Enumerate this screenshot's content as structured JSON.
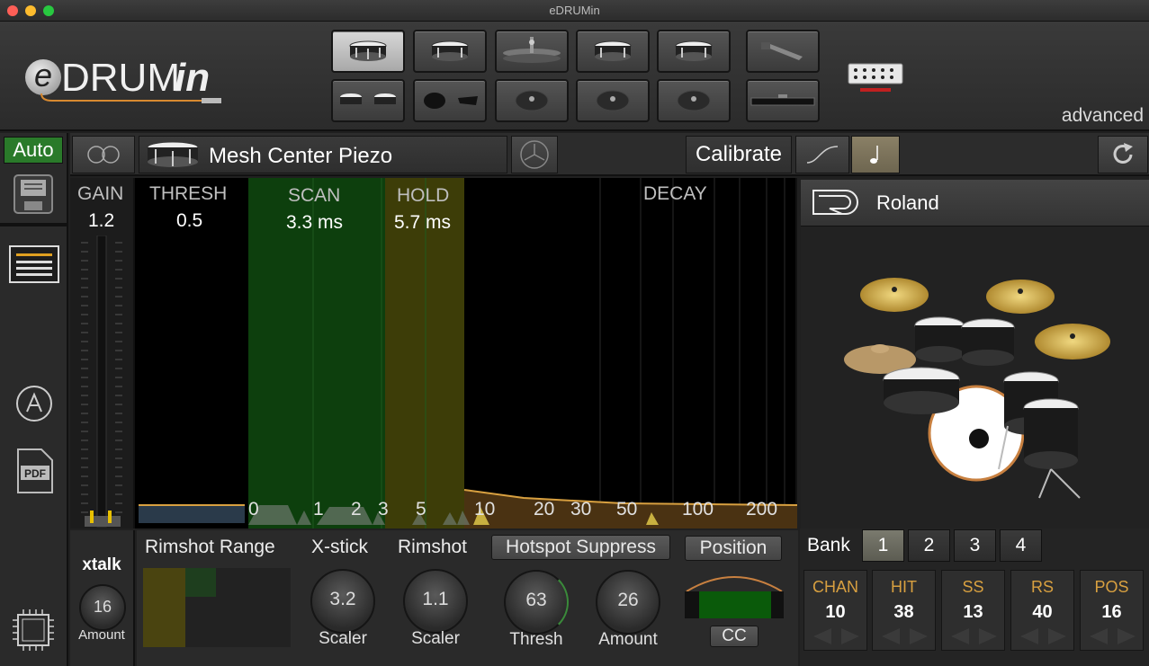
{
  "window": {
    "title": "eDRUMin"
  },
  "logo": {
    "e": "e",
    "drum": "DRUM",
    "in": "in"
  },
  "header": {
    "mode_label": "advanced"
  },
  "sidebar": {
    "auto_label": "Auto"
  },
  "toolbar": {
    "pad_name": "Mesh Center Piezo",
    "calibrate_label": "Calibrate"
  },
  "graph": {
    "gain_label": "GAIN",
    "gain_value": "1.2",
    "thresh_label": "THRESH",
    "thresh_value": "0.5",
    "scan_label": "SCAN",
    "scan_value": "3.3 ms",
    "hold_label": "HOLD",
    "hold_value": "5.7 ms",
    "decay_label": "DECAY",
    "ticks": [
      "0",
      "1",
      "2",
      "3",
      "5",
      "10",
      "20",
      "30",
      "50",
      "100",
      "200"
    ]
  },
  "kit": {
    "brand": "Roland"
  },
  "xtalk": {
    "label": "xtalk",
    "value": "16",
    "caption": "Amount"
  },
  "bottom": {
    "rimshot_range_label": "Rimshot Range",
    "xstick_label": "X-stick",
    "xstick_value": "3.2",
    "xstick_caption": "Scaler",
    "rimshot_label": "Rimshot",
    "rimshot_value": "1.1",
    "rimshot_caption": "Scaler",
    "hotspot_label": "Hotspot Suppress",
    "thresh_value": "63",
    "thresh_caption": "Thresh",
    "amount_value": "26",
    "amount_caption": "Amount",
    "position_label": "Position",
    "cc_label": "CC"
  },
  "bank": {
    "label": "Bank",
    "buttons": [
      "1",
      "2",
      "3",
      "4"
    ],
    "selected": "1",
    "params": [
      {
        "label": "CHAN",
        "value": "10"
      },
      {
        "label": "HIT",
        "value": "38"
      },
      {
        "label": "SS",
        "value": "13"
      },
      {
        "label": "RS",
        "value": "40"
      },
      {
        "label": "POS",
        "value": "16"
      }
    ]
  },
  "icons": [
    "close-icon",
    "minimize-icon",
    "zoom-icon",
    "snare-icon",
    "tom-icon",
    "hihat-icon",
    "cymbal-icon",
    "pedal-icon",
    "rail-icon",
    "connector-icon",
    "link-icon",
    "yamaha-icon",
    "curve-icon",
    "note-icon",
    "refresh-icon",
    "save-icon",
    "list-icon",
    "a-circle-icon",
    "pdf-icon",
    "chip-icon",
    "roland-logo"
  ],
  "colors": {
    "accent_green": "#2a7a2a",
    "scan_green": "#0e4a0e",
    "hold_olive": "#3a3a06",
    "decay_brown": "#4a3212",
    "orange": "#d8a040"
  }
}
